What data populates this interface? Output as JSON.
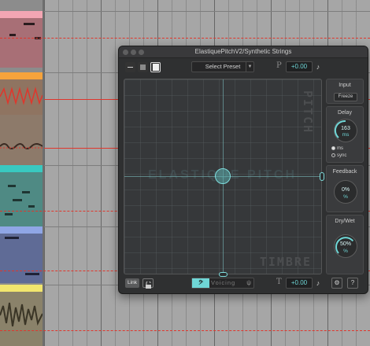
{
  "plugin": {
    "window_title": "ElastiquePitchV2/Synthetic Strings",
    "preset_label": "Select Preset",
    "pitch_value": "+0.00",
    "transpose_value": "+0.00",
    "pad_axis_y_label": "PITCH",
    "pad_axis_x_label": "TIMBRE",
    "pad_watermark": "ELASTIQUE PITCH",
    "accent_color": "#6fd6d6",
    "input": {
      "title": "Input",
      "freeze_label": "Freeze"
    },
    "delay": {
      "title": "Delay",
      "value": "163",
      "unit": "ms",
      "mode_ms": "ms",
      "mode_sync": "sync",
      "knob_level": 0.45
    },
    "feedback": {
      "title": "Feedback",
      "value": "0%",
      "unit": "%",
      "knob_level": 0.0
    },
    "dry_wet": {
      "title": "Dry/Wet",
      "value": "50%",
      "unit": "%",
      "knob_level": 0.5
    },
    "bottom": {
      "link_label": "Link",
      "voicing_label": "Voicing",
      "help_label": "?"
    }
  },
  "icons": [
    "view-compact-icon",
    "view-medium-icon",
    "view-large-icon",
    "dropdown-arrow-icon",
    "pitch-p-icon",
    "note-icon",
    "lock-icon",
    "bass-clef-icon",
    "tuning-fork-icon",
    "transpose-t-icon",
    "gear-icon",
    "help-icon"
  ]
}
